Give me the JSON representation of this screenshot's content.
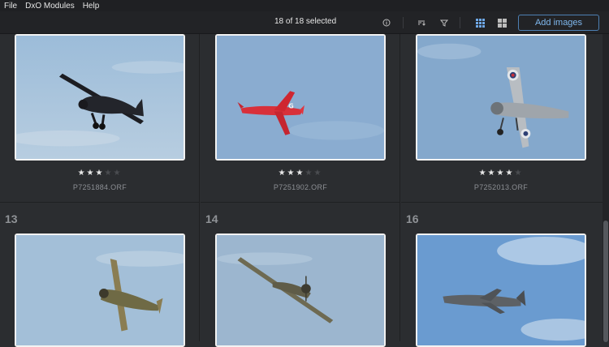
{
  "menu": {
    "items": [
      "File",
      "DxO Modules",
      "Help"
    ]
  },
  "toolbar": {
    "selection": "18 of 18 selected",
    "add_images": "Add images",
    "icons": [
      "info-icon",
      "sort-icon",
      "filter-icon",
      "grid-view-icon",
      "compare-view-icon"
    ]
  },
  "grid": {
    "row1": [
      {
        "rating": 3,
        "max_rating": 5,
        "filename": "P7251884.ORF"
      },
      {
        "rating": 3,
        "max_rating": 5,
        "filename": "P7251902.ORF"
      },
      {
        "rating": 4,
        "max_rating": 5,
        "filename": "P7252013.ORF"
      }
    ],
    "row2": [
      {
        "index": "13"
      },
      {
        "index": "14"
      },
      {
        "index": "16"
      }
    ]
  },
  "colors": {
    "accent": "#4d7fb3",
    "accent_text": "#7fb8ee",
    "sky": "#8fb0cf"
  }
}
